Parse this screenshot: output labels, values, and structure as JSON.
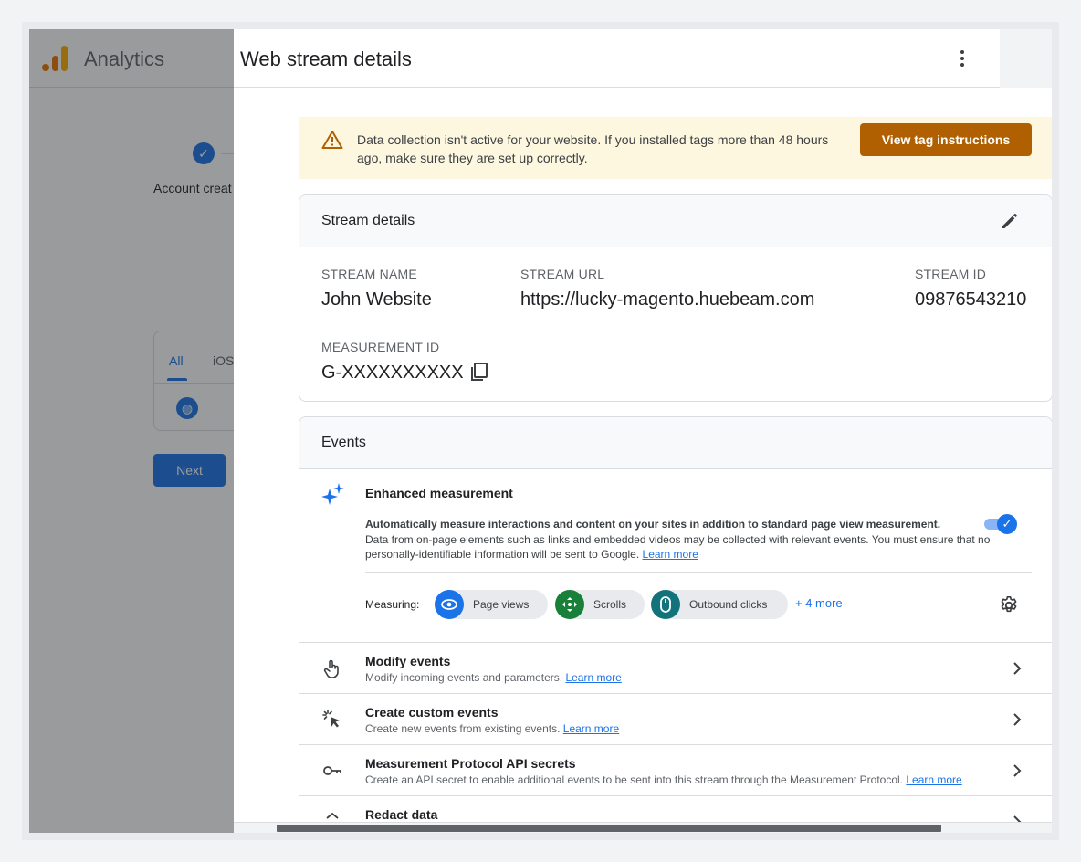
{
  "background": {
    "app_title": "Analytics",
    "step_label": "Account creat",
    "tabs": [
      "All",
      "iOS"
    ],
    "next_label": "Next"
  },
  "drawer": {
    "title": "Web stream details"
  },
  "banner": {
    "message": "Data collection isn't active for your website. If you installed tags more than 48 hours ago, make sure they are set up correctly.",
    "button_label": "View tag instructions"
  },
  "stream_details": {
    "heading": "Stream details",
    "stream_name_label": "STREAM NAME",
    "stream_name": "John Website",
    "stream_url_label": "STREAM URL",
    "stream_url": "https://lucky-magento.huebeam.com",
    "stream_id_label": "STREAM ID",
    "stream_id": "09876543210",
    "measurement_id_label": "MEASUREMENT ID",
    "measurement_id": "G-XXXXXXXXXX"
  },
  "events": {
    "heading": "Events",
    "enhanced": {
      "title": "Enhanced measurement",
      "desc_strong": "Automatically measure interactions and content on your sites in addition to standard page view measurement.",
      "desc": "Data from on-page elements such as links and embedded videos may be collected with relevant events. You must ensure that no personally-identifiable information will be sent to Google.",
      "learn_more": "Learn more",
      "enabled": true,
      "measuring_label": "Measuring:",
      "chips": [
        {
          "label": "Page views",
          "icon": "eye-icon",
          "color": "#1a73e8"
        },
        {
          "label": "Scrolls",
          "icon": "scroll-icon",
          "color": "#188038"
        },
        {
          "label": "Outbound clicks",
          "icon": "mouse-icon",
          "color": "#12737a"
        }
      ],
      "more_label": "+ 4 more"
    },
    "rows": [
      {
        "title": "Modify events",
        "sub": "Modify incoming events and parameters.",
        "learn_more": "Learn more",
        "icon": "touch-icon"
      },
      {
        "title": "Create custom events",
        "sub": "Create new events from existing events.",
        "learn_more": "Learn more",
        "icon": "cursor-click-icon"
      },
      {
        "title": "Measurement Protocol API secrets",
        "sub": "Create an API secret to enable additional events to be sent into this stream through the Measurement Protocol.",
        "learn_more": "Learn more",
        "icon": "key-icon"
      },
      {
        "title": "Redact data",
        "icon": "redact-icon"
      }
    ]
  }
}
